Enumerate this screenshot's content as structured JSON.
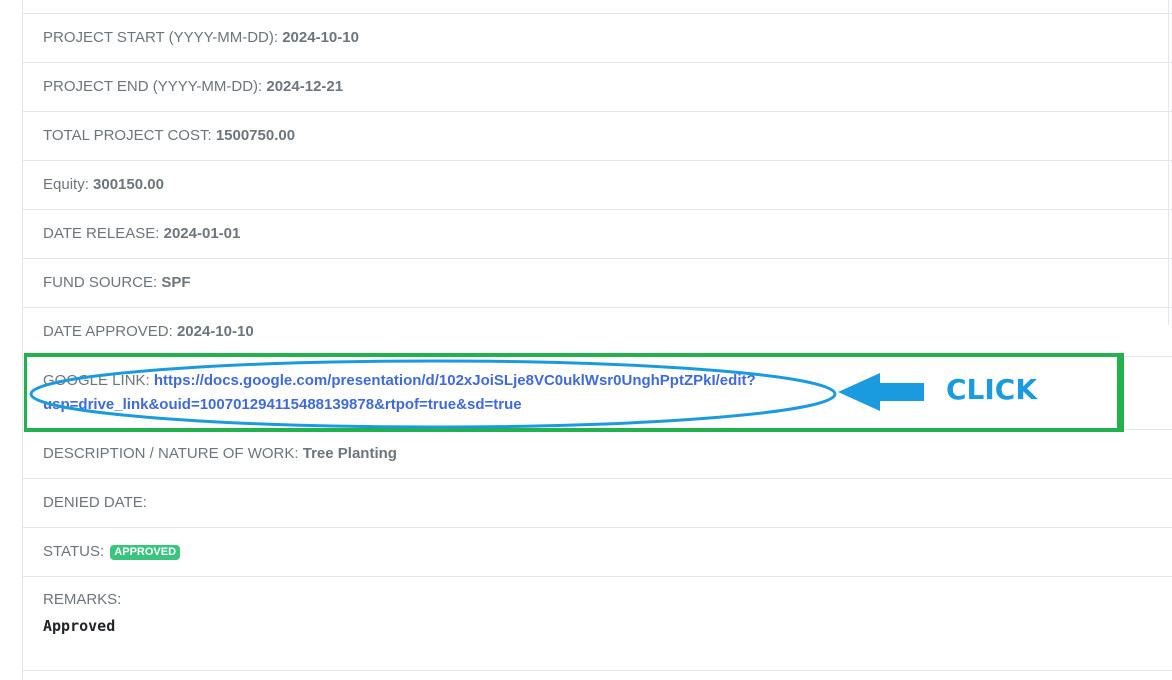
{
  "details": {
    "project_start": {
      "label": "PROJECT START (YYYY-MM-DD):",
      "value": "2024-10-10"
    },
    "project_end": {
      "label": "PROJECT END (YYYY-MM-DD):",
      "value": "2024-12-21"
    },
    "total_project_cost": {
      "label": "TOTAL PROJECT COST:",
      "value": "1500750.00"
    },
    "equity": {
      "label": "Equity:",
      "value": "300150.00"
    },
    "date_release": {
      "label": "DATE RELEASE:",
      "value": "2024-01-01"
    },
    "fund_source": {
      "label": "FUND SOURCE:",
      "value": "SPF"
    },
    "date_approved": {
      "label": "DATE APPROVED:",
      "value": "2024-10-10"
    },
    "google_link": {
      "label": "GOOGLE LINK:",
      "line1": "https://docs.google.com/presentation/d/102xJoiSLje8VC0uklWsr0UnghPptZPkI/edit?",
      "line2": "usp=drive_link&ouid=100701294115488139878&rtpof=true&sd=true"
    },
    "description": {
      "label": "DESCRIPTION / NATURE OF WORK:",
      "value": "Tree Planting"
    },
    "denied_date": {
      "label": "DENIED DATE:",
      "value": ""
    },
    "status": {
      "label": "STATUS:",
      "badge": "APPROVED",
      "badge_color": "#3ac47d"
    },
    "remarks": {
      "label": "REMARKS:",
      "value": "Approved"
    }
  },
  "annotation": {
    "callout_text": "CLICK",
    "box_color": "#21b14d",
    "ellipse_color": "#1a9be0",
    "arrow_color": "#1a9be0"
  },
  "colors": {
    "link": "#3f6ad8",
    "text_muted": "#6c757d",
    "border": "#e3e6ea"
  }
}
